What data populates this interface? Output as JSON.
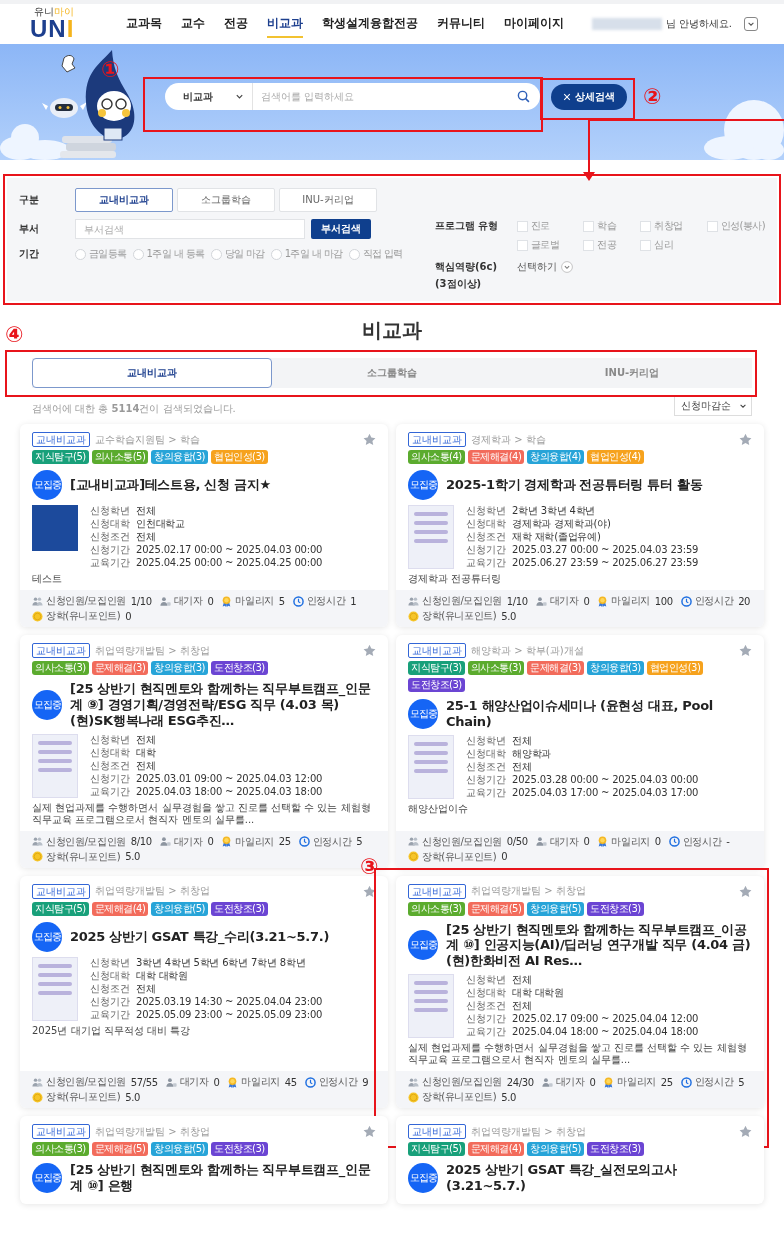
{
  "header": {
    "logo": {
      "caption": "유니마이",
      "wordmark": "UNI"
    },
    "nav": [
      {
        "label": "교과목",
        "selected": false
      },
      {
        "label": "교수",
        "selected": false
      },
      {
        "label": "전공",
        "selected": false
      },
      {
        "label": "비교과",
        "selected": true
      },
      {
        "label": "학생설계융합전공",
        "selected": false
      },
      {
        "label": "커뮤니티",
        "selected": false
      },
      {
        "label": "마이페이지",
        "selected": false
      }
    ],
    "greeting": "님 안녕하세요."
  },
  "search": {
    "category": "비교과",
    "placeholder": "검색어를 입력하세요",
    "detail_button": "상세검색"
  },
  "filters": {
    "division_label": "구분",
    "divisions": [
      {
        "label": "교내비교과",
        "selected": true
      },
      {
        "label": "소그룹학습",
        "selected": false
      },
      {
        "label": "INU-커리업",
        "selected": false
      }
    ],
    "department_label": "부서",
    "department_placeholder": "부서검색",
    "department_button": "부서검색",
    "period_label": "기간",
    "periods": [
      {
        "label": "금일등록",
        "checked": false
      },
      {
        "label": "1주일 내 등록",
        "checked": false
      },
      {
        "label": "당일 마감",
        "checked": false
      },
      {
        "label": "1주일 내 마감",
        "checked": false
      },
      {
        "label": "직접 입력",
        "checked": false
      }
    ],
    "program_type_label": "프로그램 유형",
    "program_types": [
      {
        "label": "진로",
        "checked": false
      },
      {
        "label": "학습",
        "checked": false
      },
      {
        "label": "취창업",
        "checked": false
      },
      {
        "label": "인성(봉사)",
        "checked": false
      },
      {
        "label": "글로벌",
        "checked": false
      },
      {
        "label": "전공",
        "checked": false
      },
      {
        "label": "심리",
        "checked": false
      }
    ],
    "competency_label": "핵심역량(6c)",
    "competency_note": "(3점이상)",
    "competency_select": "선택하기"
  },
  "section_title": "비교과",
  "tabs": [
    {
      "label": "교내비교과",
      "selected": true
    },
    {
      "label": "소그룹학습",
      "selected": false
    },
    {
      "label": "INU-커리업",
      "selected": false
    }
  ],
  "result_text": "검색어에 대한 총 **5114**건이 검색되었습니다.",
  "sort": "신청마감순",
  "cards": [
    {
      "badge": "교내비교과",
      "dept": "교수학습지원팀 > 학습",
      "starred": false,
      "tags": [
        {
          "label": "지식탐구(5)",
          "color": "#18a07a"
        },
        {
          "label": "의사소통(5)",
          "color": "#5bab2e"
        },
        {
          "label": "창의융합(3)",
          "color": "#27a4d8"
        },
        {
          "label": "협업인성(3)",
          "color": "#f6a21d"
        }
      ],
      "status": "모집중",
      "title": "[교내비교과]테스트용, 신청 금지★",
      "thumbnail": {
        "kind": "logo"
      },
      "info": [
        {
          "label": "신청학년",
          "value": "전체"
        },
        {
          "label": "신청대학",
          "value": "인천대학교"
        },
        {
          "label": "신청조건",
          "value": "전체"
        },
        {
          "label": "신청기간",
          "value": "2025.02.17 00:00 ~ 2025.04.03 00:00"
        },
        {
          "label": "교육기간",
          "value": "2025.04.25 00:00 ~ 2025.04.25 00:00"
        }
      ],
      "description": "테스트",
      "stats": [
        {
          "kind": "applicants",
          "label": "신청인원/모집인원",
          "value": "1/10"
        },
        {
          "kind": "waitlist",
          "label": "대기자",
          "value": "0"
        },
        {
          "kind": "mileage",
          "label": "마일리지",
          "value": "5"
        },
        {
          "kind": "hours",
          "label": "인정시간",
          "value": "1"
        },
        {
          "kind": "scholarship",
          "label": "장학(유니포인트)",
          "value": "0"
        }
      ]
    },
    {
      "badge": "교내비교과",
      "dept": "경제학과 > 학습",
      "starred": false,
      "tags": [
        {
          "label": "의사소통(4)",
          "color": "#5bab2e"
        },
        {
          "label": "문제해결(4)",
          "color": "#f26b5b"
        },
        {
          "label": "창의융합(4)",
          "color": "#27a4d8"
        },
        {
          "label": "협업인성(4)",
          "color": "#f6a21d"
        }
      ],
      "status": "모집중",
      "title": "2025-1학기 경제학과 전공튜터링 튜터 활동",
      "thumbnail": {
        "kind": "poster"
      },
      "info": [
        {
          "label": "신청학년",
          "value": "2학년 3학년 4학년"
        },
        {
          "label": "신청대학",
          "value": "경제학과 경제학과(야)"
        },
        {
          "label": "신청조건",
          "value": "재학 재학(졸업유예)"
        },
        {
          "label": "신청기간",
          "value": "2025.03.27 00:00 ~ 2025.04.03 23:59"
        },
        {
          "label": "교육기간",
          "value": "2025.06.27 23:59 ~ 2025.06.27 23:59"
        }
      ],
      "description": "경제학과 전공튜터링",
      "stats": [
        {
          "kind": "applicants",
          "label": "신청인원/모집인원",
          "value": "1/10"
        },
        {
          "kind": "waitlist",
          "label": "대기자",
          "value": "0"
        },
        {
          "kind": "mileage",
          "label": "마일리지",
          "value": "100"
        },
        {
          "kind": "hours",
          "label": "인정시간",
          "value": "20"
        },
        {
          "kind": "scholarship",
          "label": "장학(유니포인트)",
          "value": "5.0"
        }
      ]
    },
    {
      "badge": "교내비교과",
      "dept": "취업역량개발팀 > 취창업",
      "starred": false,
      "tags": [
        {
          "label": "의사소통(3)",
          "color": "#5bab2e"
        },
        {
          "label": "문제해결(3)",
          "color": "#f26b5b"
        },
        {
          "label": "창의융합(3)",
          "color": "#27a4d8"
        },
        {
          "label": "도전창조(3)",
          "color": "#6b45d3"
        }
      ],
      "status": "모집중",
      "title": "[25 상반기 현직멘토와 함께하는 직무부트캠프_인문계 ⑨] 경영기획/경영전략/ESG 직무 (4.03 목) (현)SK행복나래 ESG추진…",
      "thumbnail": {
        "kind": "poster"
      },
      "info": [
        {
          "label": "신청학년",
          "value": "전체"
        },
        {
          "label": "신청대학",
          "value": "대학"
        },
        {
          "label": "신청조건",
          "value": "전체"
        },
        {
          "label": "신청기간",
          "value": "2025.03.01 09:00 ~ 2025.04.03 12:00"
        },
        {
          "label": "교육기간",
          "value": "2025.04.03 18:00 ~ 2025.04.03 18:00"
        }
      ],
      "description": "실제 현업과제를 수행하면서 실무경험을 쌓고 진로를 선택할 수 있는 체험형 직무교육 프로그램으로서 현직자 멘토의 실무를...",
      "stats": [
        {
          "kind": "applicants",
          "label": "신청인원/모집인원",
          "value": "8/10"
        },
        {
          "kind": "waitlist",
          "label": "대기자",
          "value": "0"
        },
        {
          "kind": "mileage",
          "label": "마일리지",
          "value": "25"
        },
        {
          "kind": "hours",
          "label": "인정시간",
          "value": "5"
        },
        {
          "kind": "scholarship",
          "label": "장학(유니포인트)",
          "value": "5.0"
        }
      ]
    },
    {
      "badge": "교내비교과",
      "dept": "해양학과 > 학부(과)개설",
      "starred": false,
      "tags": [
        {
          "label": "지식탐구(3)",
          "color": "#18a07a"
        },
        {
          "label": "의사소통(3)",
          "color": "#5bab2e"
        },
        {
          "label": "문제해결(3)",
          "color": "#f26b5b"
        },
        {
          "label": "창의융합(3)",
          "color": "#27a4d8"
        },
        {
          "label": "협업인성(3)",
          "color": "#f6a21d"
        },
        {
          "label": "도전창조(3)",
          "color": "#6b45d3"
        }
      ],
      "status": "모집중",
      "title": "25-1 해양산업이슈세미나 (윤현성 대표, Pool Chain)",
      "thumbnail": {
        "kind": "poster"
      },
      "info": [
        {
          "label": "신청학년",
          "value": "전체"
        },
        {
          "label": "신청대학",
          "value": "해양학과"
        },
        {
          "label": "신청조건",
          "value": "전체"
        },
        {
          "label": "신청기간",
          "value": "2025.03.28 00:00 ~ 2025.04.03 00:00"
        },
        {
          "label": "교육기간",
          "value": "2025.04.03 17:00 ~ 2025.04.03 17:00"
        }
      ],
      "description": "해양산업이슈",
      "stats": [
        {
          "kind": "applicants",
          "label": "신청인원/모집인원",
          "value": "0/50"
        },
        {
          "kind": "waitlist",
          "label": "대기자",
          "value": "0"
        },
        {
          "kind": "mileage",
          "label": "마일리지",
          "value": "0"
        },
        {
          "kind": "hours",
          "label": "인정시간",
          "value": "-"
        },
        {
          "kind": "scholarship",
          "label": "장학(유니포인트)",
          "value": "0"
        }
      ]
    },
    {
      "badge": "교내비교과",
      "dept": "취업역량개발팀 > 취창업",
      "starred": false,
      "tags": [
        {
          "label": "지식탐구(5)",
          "color": "#18a07a"
        },
        {
          "label": "문제해결(4)",
          "color": "#f26b5b"
        },
        {
          "label": "창의융합(5)",
          "color": "#27a4d8"
        },
        {
          "label": "도전창조(3)",
          "color": "#6b45d3"
        }
      ],
      "status": "모집중",
      "title": "2025 상반기 GSAT 특강_수리(3.21~5.7.)",
      "thumbnail": {
        "kind": "poster"
      },
      "info": [
        {
          "label": "신청학년",
          "value": "3학년 4학년 5학년 6학년 7학년 8학년"
        },
        {
          "label": "신청대학",
          "value": "대학 대학원"
        },
        {
          "label": "신청조건",
          "value": "전체"
        },
        {
          "label": "신청기간",
          "value": "2025.03.19 14:30 ~ 2025.04.04 23:00"
        },
        {
          "label": "교육기간",
          "value": "2025.05.09 23:00 ~ 2025.05.09 23:00"
        }
      ],
      "description": "2025년 대기업 직무적성 대비 특강",
      "stats": [
        {
          "kind": "applicants",
          "label": "신청인원/모집인원",
          "value": "57/55"
        },
        {
          "kind": "waitlist",
          "label": "대기자",
          "value": "0"
        },
        {
          "kind": "mileage",
          "label": "마일리지",
          "value": "45"
        },
        {
          "kind": "hours",
          "label": "인정시간",
          "value": "9"
        },
        {
          "kind": "scholarship",
          "label": "장학(유니포인트)",
          "value": "5.0"
        }
      ]
    },
    {
      "badge": "교내비교과",
      "dept": "취업역량개발팀 > 취창업",
      "starred": false,
      "tags": [
        {
          "label": "의사소통(3)",
          "color": "#5bab2e"
        },
        {
          "label": "문제해결(5)",
          "color": "#f26b5b"
        },
        {
          "label": "창의융합(5)",
          "color": "#27a4d8"
        },
        {
          "label": "도전창조(3)",
          "color": "#6b45d3"
        }
      ],
      "status": "모집중",
      "title": "[25 상반기 현직멘토와 함께하는 직무부트캠프_이공계 ⑩] 인공지능(AI)/딥러닝 연구개발 직무 (4.04 금) (현)한화비전 AI Res…",
      "thumbnail": {
        "kind": "poster"
      },
      "info": [
        {
          "label": "신청학년",
          "value": "전체"
        },
        {
          "label": "신청대학",
          "value": "대학 대학원"
        },
        {
          "label": "신청조건",
          "value": "전체"
        },
        {
          "label": "신청기간",
          "value": "2025.02.17 09:00 ~ 2025.04.04 12:00"
        },
        {
          "label": "교육기간",
          "value": "2025.04.04 18:00 ~ 2025.04.04 18:00"
        }
      ],
      "description": "실제 현업과제를 수행하면서 실무경험을 쌓고 진로를 선택할 수 있는 체험형 직무교육 프로그램으로서 현직자 멘토의 실무를...",
      "stats": [
        {
          "kind": "applicants",
          "label": "신청인원/모집인원",
          "value": "24/30"
        },
        {
          "kind": "waitlist",
          "label": "대기자",
          "value": "0"
        },
        {
          "kind": "mileage",
          "label": "마일리지",
          "value": "25"
        },
        {
          "kind": "hours",
          "label": "인정시간",
          "value": "5"
        },
        {
          "kind": "scholarship",
          "label": "장학(유니포인트)",
          "value": "5.0"
        }
      ]
    },
    {
      "badge": "교내비교과",
      "dept": "취업역량개발팀 > 취창업",
      "starred": false,
      "tags": [
        {
          "label": "의사소통(3)",
          "color": "#5bab2e"
        },
        {
          "label": "문제해결(5)",
          "color": "#f26b5b"
        },
        {
          "label": "창의융합(5)",
          "color": "#27a4d8"
        },
        {
          "label": "도전창조(3)",
          "color": "#6b45d3"
        }
      ],
      "status": "모집중",
      "title": "[25 상반기 현직멘토와 함께하는 직무부트캠프_인문계 ⑩] 은행"
    },
    {
      "badge": "교내비교과",
      "dept": "취업역량개발팀 > 취창업",
      "starred": false,
      "tags": [
        {
          "label": "지식탐구(5)",
          "color": "#18a07a"
        },
        {
          "label": "문제해결(4)",
          "color": "#f26b5b"
        },
        {
          "label": "창의융합(5)",
          "color": "#27a4d8"
        },
        {
          "label": "도전창조(3)",
          "color": "#6b45d3"
        }
      ],
      "status": "모집중",
      "title": "2025 상반기 GSAT 특강_실전모의고사(3.21~5.7.)"
    }
  ],
  "annotations": [
    {
      "number": "①"
    },
    {
      "number": "②"
    },
    {
      "number": "③"
    },
    {
      "number": "④"
    }
  ]
}
